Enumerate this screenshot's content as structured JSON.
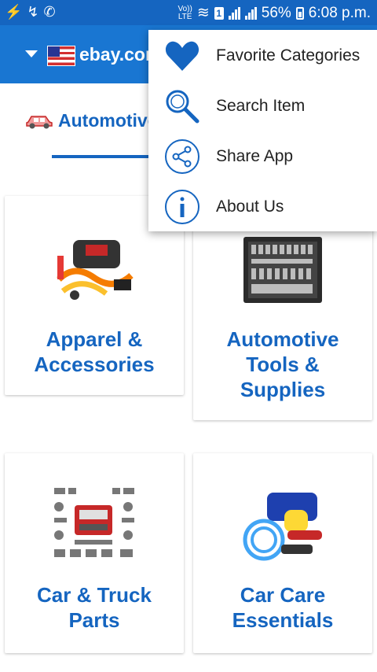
{
  "status_bar": {
    "left_icons": [
      "flash-icon",
      "missed-call-icon",
      "whatsapp-icon"
    ],
    "network_label_top": "Vo))",
    "network_label_bottom": "LTE",
    "notification_badge": "1",
    "battery_percent": "56%",
    "time": "6:08 p.m."
  },
  "app_bar": {
    "site": "ebay.com",
    "flag": "us-flag"
  },
  "tab": {
    "label": "Automotive"
  },
  "cards": [
    {
      "title_line1": "Apparel &",
      "title_line2": "Accessories",
      "title_line3": ""
    },
    {
      "title_line1": "Automotive",
      "title_line2": "Tools &",
      "title_line3": "Supplies"
    },
    {
      "title_line1": "Car & Truck",
      "title_line2": "Parts",
      "title_line3": ""
    },
    {
      "title_line1": "Car Care",
      "title_line2": "Essentials",
      "title_line3": ""
    }
  ],
  "menu": {
    "items": [
      {
        "label": "Favorite Categories",
        "icon": "heart-icon"
      },
      {
        "label": "Search Item",
        "icon": "search-icon"
      },
      {
        "label": "Share App",
        "icon": "share-icon"
      },
      {
        "label": "About Us",
        "icon": "info-icon"
      }
    ]
  },
  "colors": {
    "primary": "#1976d2",
    "primary_dark": "#1565c0",
    "accent_text": "#1565c0"
  }
}
